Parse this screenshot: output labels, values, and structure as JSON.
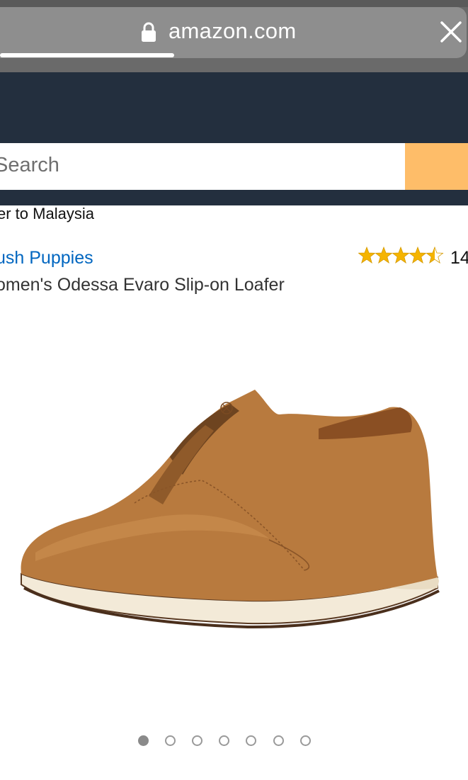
{
  "browser": {
    "url": "amazon.com",
    "icons": {
      "lock": "lock-icon",
      "close": "close-icon"
    }
  },
  "search": {
    "placeholder": "Search"
  },
  "delivery": {
    "text": "er to Malaysia"
  },
  "product": {
    "brand": "ush Puppies",
    "title": "omen's Odessa Evaro Slip-on Loafer",
    "rating": 4.5,
    "rating_count": "14",
    "image_description_icon": "product-image"
  },
  "carousel": {
    "total": 7,
    "active": 1
  },
  "colors": {
    "header_bg": "#232f3e",
    "search_button": "#febd69",
    "link_blue": "#0066c0",
    "star": "#f5b400"
  }
}
